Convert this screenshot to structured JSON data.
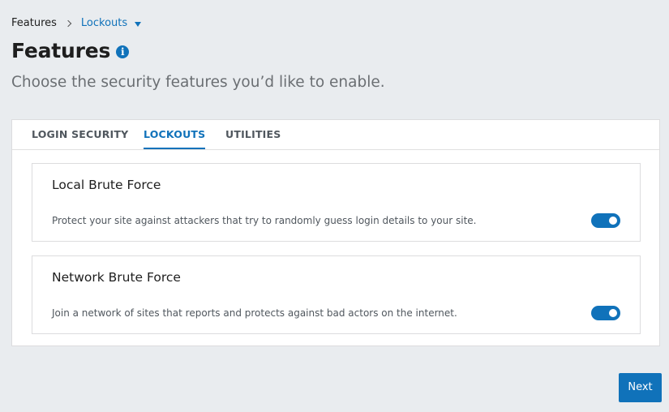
{
  "breadcrumb": {
    "root": "Features",
    "current": "Lockouts"
  },
  "header": {
    "title": "Features",
    "info_icon": "info-icon",
    "subtitle": "Choose the security features you’d like to enable."
  },
  "tabs": [
    {
      "label": "LOGIN SECURITY",
      "active": false
    },
    {
      "label": "LOCKOUTS",
      "active": true
    },
    {
      "label": "UTILITIES",
      "active": false
    }
  ],
  "features": [
    {
      "title": "Local Brute Force",
      "description": "Protect your site against attackers that try to randomly guess login details to your site.",
      "enabled": true
    },
    {
      "title": "Network Brute Force",
      "description": "Join a network of sites that reports and protects against bad actors on the internet.",
      "enabled": true
    }
  ],
  "footer": {
    "next_label": "Next"
  },
  "colors": {
    "accent": "#1072ba",
    "background": "#e9ecef"
  }
}
